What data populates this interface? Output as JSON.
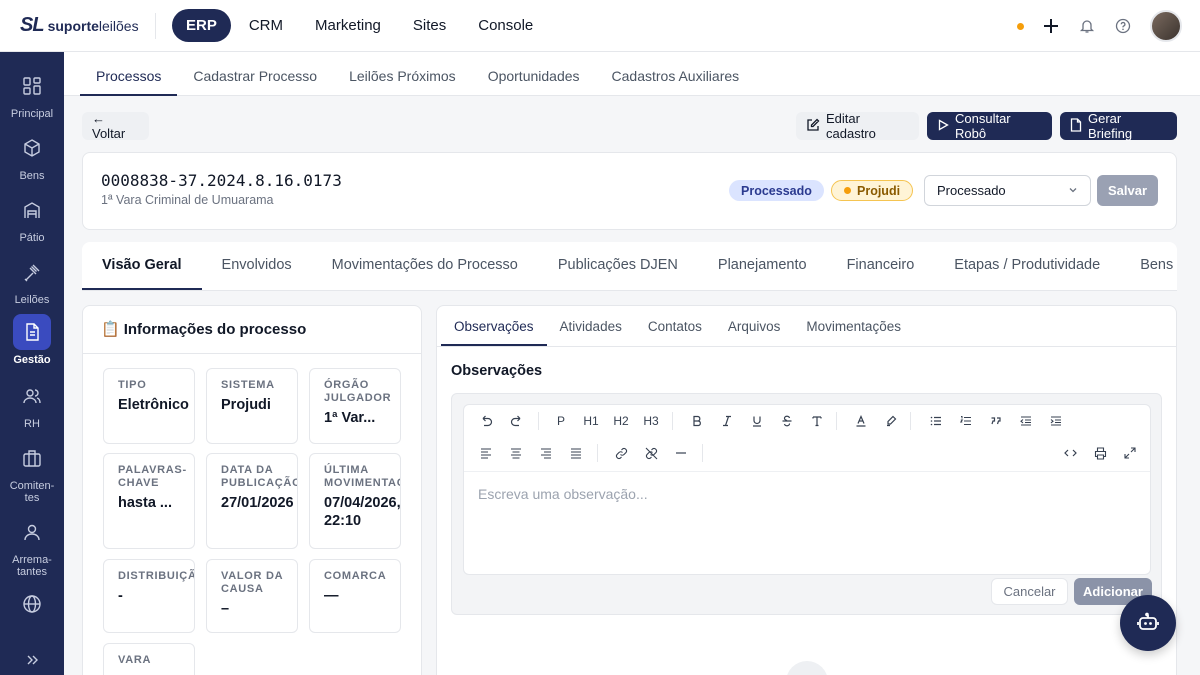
{
  "brand": {
    "mark": "SL",
    "name_bold": "suporte",
    "name_light": "leilões"
  },
  "topnav": [
    {
      "label": "ERP",
      "active": true
    },
    {
      "label": "CRM",
      "active": false
    },
    {
      "label": "Marketing",
      "active": false
    },
    {
      "label": "Sites",
      "active": false
    },
    {
      "label": "Console",
      "active": false
    }
  ],
  "sidebar": [
    {
      "label": "Principal",
      "icon": "grid-icon"
    },
    {
      "label": "Bens",
      "icon": "box-icon"
    },
    {
      "label": "Pátio",
      "icon": "warehouse-icon"
    },
    {
      "label": "Leilões",
      "icon": "gavel-icon"
    },
    {
      "label": "Gestão",
      "icon": "document-icon",
      "active": true
    },
    {
      "label": "RH",
      "icon": "users-icon"
    },
    {
      "label": "Comiten-\ntes",
      "icon": "briefcase-icon"
    },
    {
      "label": "Arrema-\ntantes",
      "icon": "user-icon"
    },
    {
      "label": "",
      "icon": "globe-icon"
    }
  ],
  "subnav": [
    {
      "label": "Processos",
      "active": true
    },
    {
      "label": "Cadastrar Processo"
    },
    {
      "label": "Leilões Próximos"
    },
    {
      "label": "Oportunidades"
    },
    {
      "label": "Cadastros Auxiliares"
    }
  ],
  "actions": {
    "back": "← Voltar",
    "edit": "Editar cadastro",
    "robot": "Consultar Robô",
    "briefing": "Gerar Briefing"
  },
  "process": {
    "number": "0008838-37.2024.8.16.0173",
    "court": "1ª Vara Criminal de Umuarama",
    "status_badge": "Processado",
    "system_badge": "Projudi",
    "status_select": "Processado",
    "save": "Salvar"
  },
  "main_tabs": [
    {
      "label": "Visão Geral",
      "active": true
    },
    {
      "label": "Envolvidos"
    },
    {
      "label": "Movimentações do Processo"
    },
    {
      "label": "Publicações DJEN"
    },
    {
      "label": "Planejamento"
    },
    {
      "label": "Financeiro"
    },
    {
      "label": "Etapas / Produtividade"
    },
    {
      "label": "Bens v"
    }
  ],
  "info": {
    "title": "Informações do processo",
    "fields": [
      {
        "label": "TIPO",
        "value": "Eletrônico"
      },
      {
        "label": "SISTEMA",
        "value": "Projudi"
      },
      {
        "label": "ÓRGÃO\nJULGADOR",
        "value": "1ª Var..."
      },
      {
        "label": "PALAVRAS-\nCHAVE",
        "value": "hasta ..."
      },
      {
        "label": "DATA DA\nPUBLICAÇÃO",
        "value": "27/01/2026"
      },
      {
        "label": "ÚLTIMA\nMOVIMENTAÇÃO",
        "value": "07/04/2026,\n22:10"
      },
      {
        "label": "DISTRIBUIÇÃO",
        "value": "-"
      },
      {
        "label": "VALOR DA\nCAUSA",
        "value": "–"
      },
      {
        "label": "COMARCA",
        "value": "—"
      },
      {
        "label": "VARA",
        "value": ""
      }
    ]
  },
  "right_tabs": [
    {
      "label": "Observações",
      "active": true
    },
    {
      "label": "Atividades"
    },
    {
      "label": "Contatos"
    },
    {
      "label": "Arquivos"
    },
    {
      "label": "Movimentações"
    }
  ],
  "observations": {
    "title": "Observações",
    "placeholder": "Escreva uma observação...",
    "cancel": "Cancelar",
    "add": "Adicionar",
    "toolbar_headings": [
      "P",
      "H1",
      "H2",
      "H3"
    ]
  }
}
